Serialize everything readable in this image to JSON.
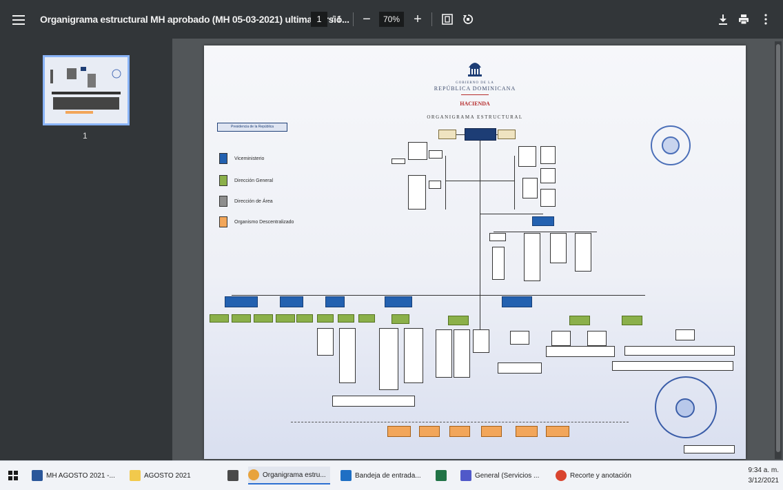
{
  "toolbar": {
    "title": "Organigrama estructural MH aprobado (MH 05-03-2021) ultima versió...",
    "page_current": "1",
    "page_total": "/ 1",
    "zoom": "70%",
    "zoom_minus": "−",
    "zoom_plus": "+"
  },
  "sidebar": {
    "thumbnail_page_number": "1"
  },
  "document": {
    "header_line1": "GOBIERNO DE LA",
    "header_line2": "REPÚBLICA DOMINICANA",
    "header_line3": "HACIENDA",
    "header_line4": "ORGANIGRAMA ESTRUCTURAL",
    "presidency_box": "Presidencia de la República",
    "legend": [
      {
        "label": "Viceministerio",
        "color": "#2361b0"
      },
      {
        "label": "Dirección General",
        "color": "#8bb04a"
      },
      {
        "label": "Dirección de Área",
        "color": "#8e8e8e"
      },
      {
        "label": "Organismo Descentralizado",
        "color": "#f2a65a"
      }
    ]
  },
  "taskbar": {
    "items": [
      {
        "label": "MH AGOSTO 2021 -...",
        "icon": "word-icon",
        "color": "#2b579a"
      },
      {
        "label": "AGOSTO 2021",
        "icon": "folder-icon",
        "color": "#f2c94c"
      },
      {
        "label": "Organigrama estru...",
        "icon": "chrome-icon",
        "color": "#e8a33d"
      },
      {
        "label": "Bandeja de entrada...",
        "icon": "outlook-icon",
        "color": "#1f6fc4"
      },
      {
        "label": "General (Servicios ...",
        "icon": "teams-icon",
        "color": "#5059c9"
      },
      {
        "label": "Recorte y anotación",
        "icon": "snip-icon",
        "color": "#d9442f"
      }
    ],
    "clock_time": "9:34 a. m.",
    "clock_date": "3/12/2021"
  }
}
